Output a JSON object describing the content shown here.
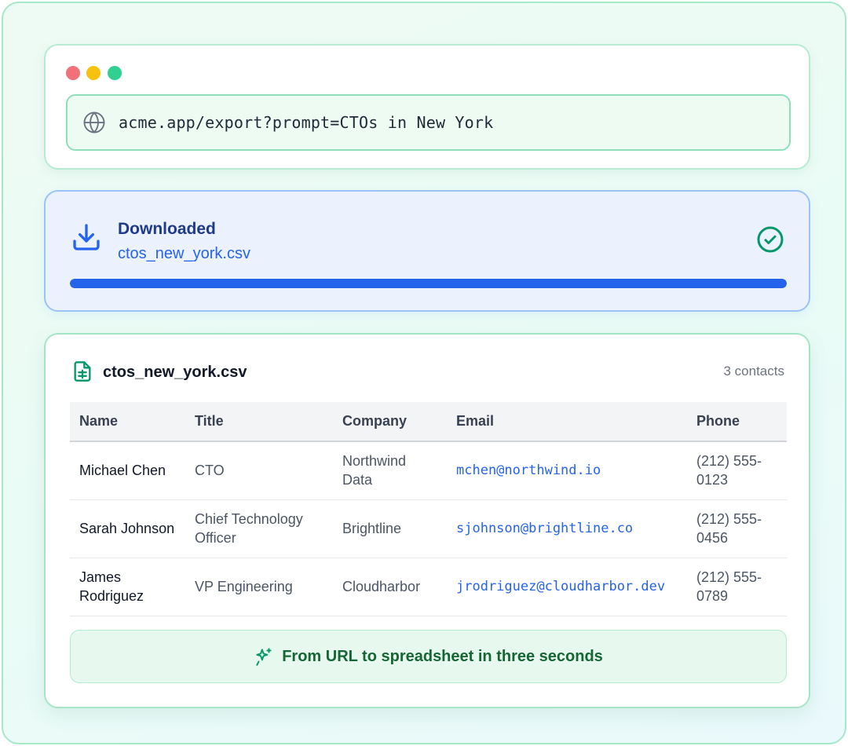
{
  "browser": {
    "url": "acme.app/export?prompt=CTOs in New York",
    "icons": {
      "globe": "globe-icon"
    }
  },
  "download": {
    "status": "Downloaded",
    "file_name": "ctos_new_york.csv",
    "progress_percent": 100,
    "icons": {
      "download": "download-icon",
      "done": "check-circle-icon"
    },
    "colors": {
      "accent": "#2563eb",
      "success": "#059669"
    }
  },
  "file_preview": {
    "file_name": "ctos_new_york.csv",
    "count_label": "3 contacts",
    "columns": [
      "Name",
      "Title",
      "Company",
      "Email",
      "Phone"
    ],
    "rows": [
      {
        "name": "Michael Chen",
        "title": "CTO",
        "company": "Northwind Data",
        "email": "mchen@northwind.io",
        "phone": "(212) 555-0123"
      },
      {
        "name": "Sarah Johnson",
        "title": "Chief Technology Officer",
        "company": "Brightline",
        "email": "sjohnson@brightline.co",
        "phone": "(212) 555-0456"
      },
      {
        "name": "James Rodriguez",
        "title": "VP Engineering",
        "company": "Cloudharbor",
        "email": "jrodriguez@cloudharbor.dev",
        "phone": "(212) 555-0789"
      }
    ]
  },
  "banner": {
    "text": "From URL to spreadsheet in three seconds",
    "icon": "sparkle-icon"
  }
}
